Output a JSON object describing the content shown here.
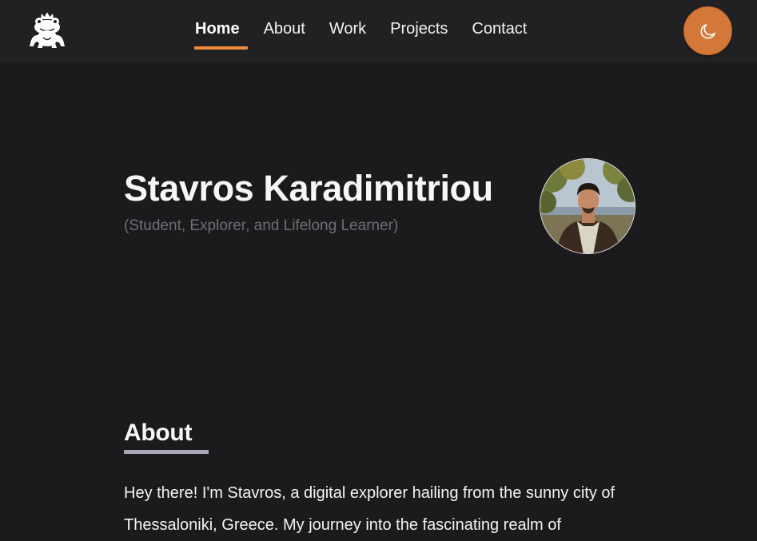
{
  "nav": {
    "items": [
      {
        "label": "Home",
        "active": true
      },
      {
        "label": "About",
        "active": false
      },
      {
        "label": "Work",
        "active": false
      },
      {
        "label": "Projects",
        "active": false
      },
      {
        "label": "Contact",
        "active": false
      }
    ]
  },
  "theme_toggle": {
    "icon": "moon-icon",
    "color": "#d4783a"
  },
  "hero": {
    "name": "Stavros Karadimitriou",
    "subtitle": "(Student, Explorer, and Lifelong Learner)"
  },
  "about": {
    "title": "About",
    "text": "Hey there! I'm Stavros, a digital explorer hailing from the sunny city of Thessaloniki, Greece. My journey into the fascinating realm of"
  },
  "colors": {
    "accent": "#f08a3c",
    "background": "#1b1b1d",
    "header_background": "#212124"
  }
}
